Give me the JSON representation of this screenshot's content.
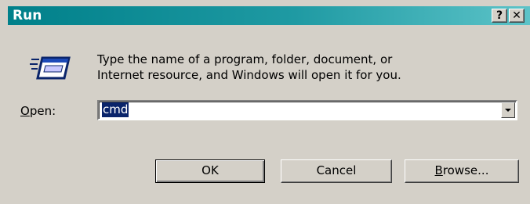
{
  "window": {
    "title": "Run",
    "help_label": "?",
    "close_label": "✕"
  },
  "description": "Type the name of a program, folder, document, or\nInternet resource, and Windows will open it for you.",
  "open": {
    "label_access": "O",
    "label_rest": "pen:",
    "value": "cmd"
  },
  "buttons": {
    "ok": "OK",
    "cancel": "Cancel",
    "browse_access": "B",
    "browse_rest": "rowse..."
  },
  "icons": {
    "run": "run-program-icon",
    "dropdown": "chevron-down-icon"
  },
  "colors": {
    "title_bar_start": "#00808a",
    "title_bar_end": "#5cc3c8",
    "selection": "#0a246a",
    "face": "#d4d0c8"
  }
}
